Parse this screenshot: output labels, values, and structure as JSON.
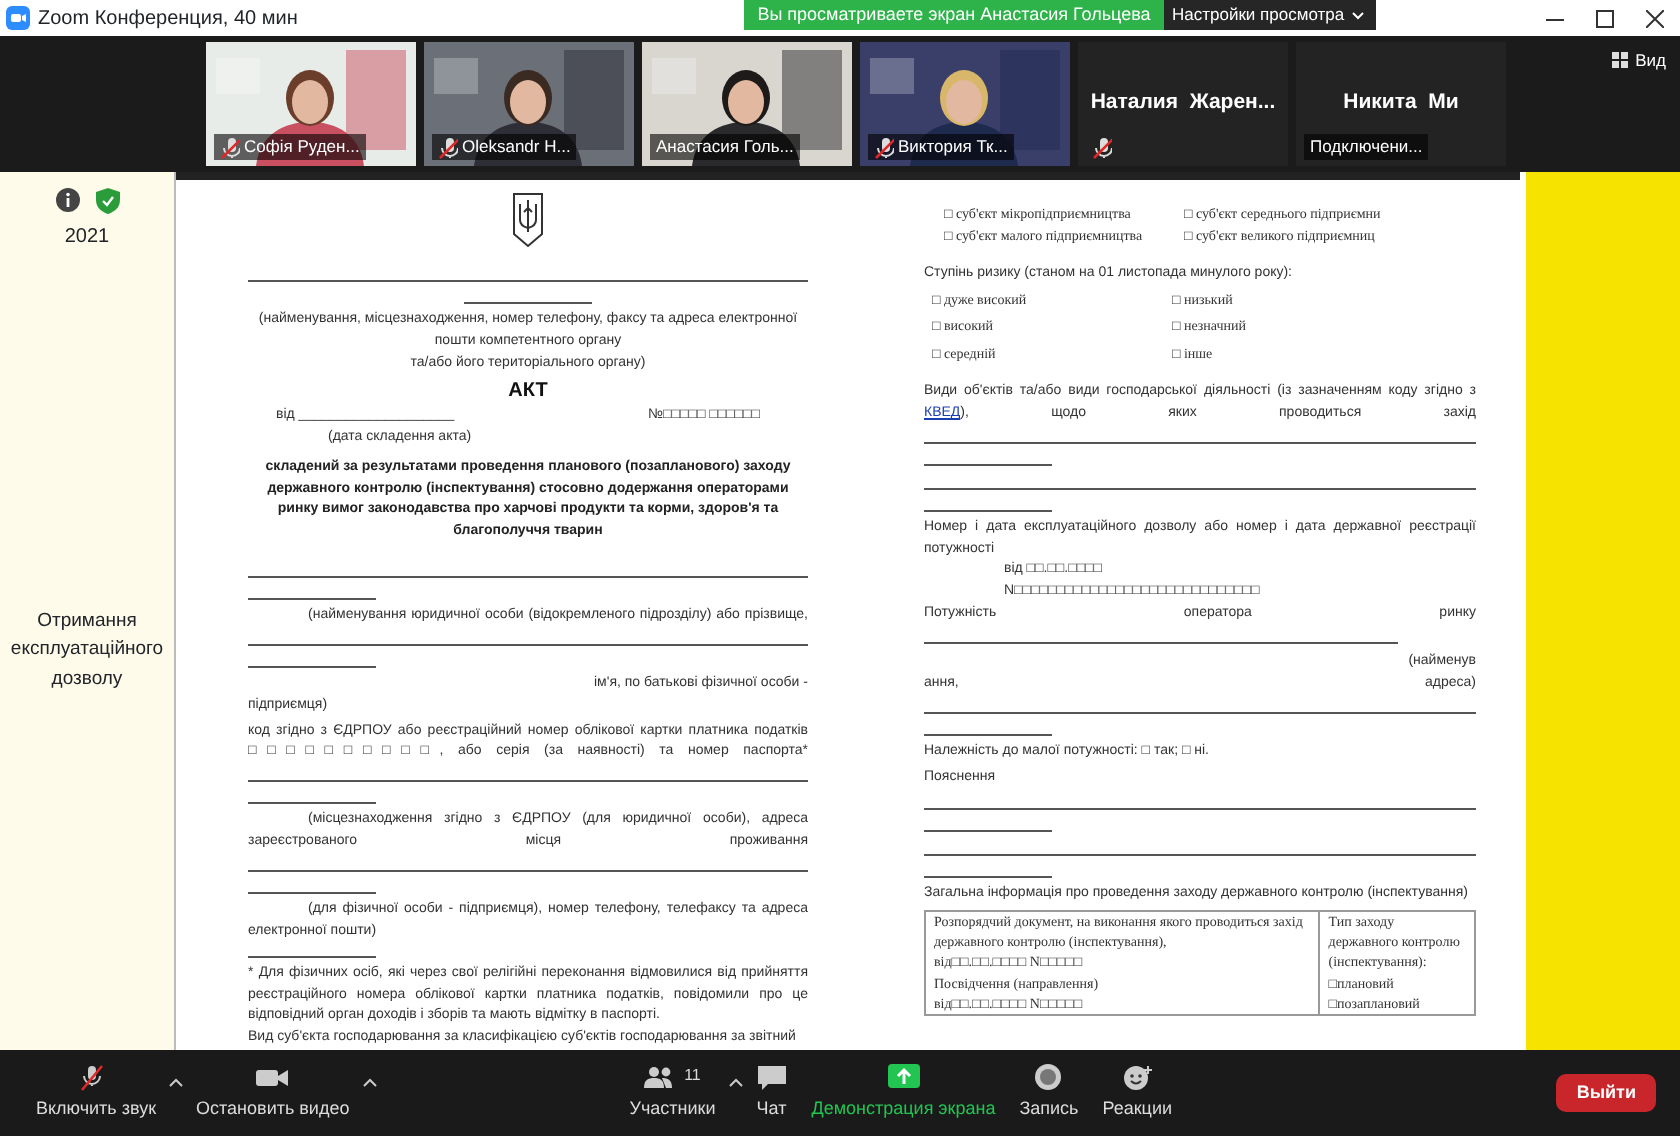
{
  "window": {
    "title": "Zoom Конференция, 40 мин"
  },
  "share_banner": {
    "text": "Вы просматриваете экран Анастасия Гольцева"
  },
  "view_options": {
    "label": "Настройки просмотра"
  },
  "view_button": {
    "label": "Вид"
  },
  "participants": [
    {
      "name": "Софія Руден...",
      "muted": true,
      "video": true,
      "speaking": false
    },
    {
      "name": "Oleksandr H...",
      "muted": true,
      "video": true,
      "speaking": false
    },
    {
      "name": "Анастасия Голь...",
      "muted": false,
      "video": true,
      "speaking": true
    },
    {
      "name": "Виктория Тк...",
      "muted": true,
      "video": true,
      "speaking": false
    },
    {
      "name": "Наталия  Жарен...",
      "muted": true,
      "video": false,
      "speaking": false
    },
    {
      "name": "Никита  Ми",
      "status": "Подключени...",
      "muted": false,
      "video": false,
      "speaking": false
    }
  ],
  "sidebar": {
    "year": "2021",
    "title": "Отримання експлуатаційного дозволу"
  },
  "document": {
    "left": [
      {
        "kind": "emblem"
      },
      {
        "kind": "rule"
      },
      {
        "kind": "short-rule-center"
      },
      {
        "kind": "center",
        "text": "(найменування, місцезнаходження, номер телефону, факсу та адреса електронної пошти компетентного органу"
      },
      {
        "kind": "center",
        "text": "та/або його територіального органу)"
      },
      {
        "kind": "title",
        "text": "АКТ"
      },
      {
        "kind": "split",
        "parts": [
          "від ____________________",
          "№□□□□□ □□□□□□"
        ]
      },
      {
        "kind": "indent",
        "text": "(дата складення акта)"
      },
      {
        "kind": "bold-center",
        "text": "складений за результатами проведення планового (позапланового) заходу державного контролю (інспектування) стосовно додержання операторами ринку вимог законодавства про харчові продукти та корми, здоров'я та благополуччя тварин"
      },
      {
        "kind": "rule"
      },
      {
        "kind": "short-rule"
      },
      {
        "kind": "justify-full-indent",
        "text": "(найменування юридичної особи (відокремленого підрозділу) або прізвище,"
      },
      {
        "kind": "rule"
      },
      {
        "kind": "short-rule"
      },
      {
        "kind": "right",
        "text": "ім'я, по батькові фізичної особи -"
      },
      {
        "kind": "plain",
        "text": "підприємця)"
      },
      {
        "kind": "justify-full",
        "text": "код згідно з ЄДРПОУ або реєстраційний номер облікової картки платника податків □□□□□□□□□□, або серія (за наявності) та номер паспорта*"
      },
      {
        "kind": "rule"
      },
      {
        "kind": "short-rule"
      },
      {
        "kind": "justify-full-indent",
        "text": "(місцезнаходження згідно з ЄДРПОУ (для юридичної особи), адреса зареєстрованого місця проживання"
      },
      {
        "kind": "rule"
      },
      {
        "kind": "short-rule"
      },
      {
        "kind": "justify-indent",
        "text": "(для фізичної особи - підприємця), номер телефону, телефаксу та адреса електронної пошти)"
      },
      {
        "kind": "short-rule"
      },
      {
        "kind": "justify",
        "text": "* Для фізичних осіб, які через свої релігійні переконання відмовилися від прийняття реєстраційного номера облікової картки платника податків, повідомили про це відповідний орган доходів і зборів та мають відмітку в паспорті."
      },
      {
        "kind": "plain",
        "text": "Вид суб'єкта господарювання за класифікацією суб'єктів господарювання за звітний"
      }
    ],
    "right": [
      {
        "kind": "checkbox-grid-wide",
        "items": [
          "□ суб'єкт мікропідприємництва",
          "□ суб'єкт середнього підприємни",
          "□ суб'єкт малого підприємництва",
          "□ суб'єкт великого підприємниц"
        ]
      },
      {
        "kind": "plain",
        "text": "Ступінь ризику (станом на 01 листопада минулого року):"
      },
      {
        "kind": "checkbox-grid",
        "items": [
          "□ дуже високий",
          "□ низький",
          "□ високий",
          "□ незначний",
          "□ середній",
          "□ інше"
        ]
      },
      {
        "kind": "link-para",
        "parts": [
          {
            "text": "Види об'єктів та/або види господарської діяльності (із зазначенням коду згідно з "
          },
          {
            "text": "КВЕД",
            "link": true
          },
          {
            "text": "), щодо яких проводиться захід"
          }
        ]
      },
      {
        "kind": "rule"
      },
      {
        "kind": "short-rule"
      },
      {
        "kind": "rule"
      },
      {
        "kind": "short-rule"
      },
      {
        "kind": "justify-full",
        "text": "Номер і дата експлуатаційного дозволу або номер і дата державної реєстрації потужності"
      },
      {
        "kind": "indent",
        "text": "від □□.□□.□□□□"
      },
      {
        "kind": "indent",
        "text": "N□□□□□□□□□□□□□□□□□□□□□□□□□□□□□"
      },
      {
        "kind": "justify-full",
        "text": "Потужність оператора ринку"
      },
      {
        "kind": "rule-long"
      },
      {
        "kind": "right",
        "text": "(найменув"
      },
      {
        "kind": "justify-full",
        "text": "ання, адреса)"
      },
      {
        "kind": "rule"
      },
      {
        "kind": "short-rule"
      },
      {
        "kind": "plain",
        "text": "Належність до малої потужності: □ так; □ ні."
      },
      {
        "kind": "plain",
        "text": "Пояснення"
      },
      {
        "kind": "rule"
      },
      {
        "kind": "short-rule"
      },
      {
        "kind": "rule"
      },
      {
        "kind": "short-rule"
      },
      {
        "kind": "plain",
        "text": "Загальна інформація про проведення заходу державного контролю (інспектування)"
      },
      {
        "kind": "table",
        "cells": [
          [
            "Розпорядчий документ, на виконання якого проводиться захід державного контролю (інспектування),",
            "від□□.□□.□□□□ N□□□□□",
            "Посвідчення (направлення)",
            "від□□.□□.□□□□ N□□□□□"
          ],
          [
            "Тип заходу державного контролю (інспектування):",
            "□плановий",
            "□позаплановий"
          ]
        ]
      }
    ]
  },
  "toolbar": {
    "items": [
      {
        "kind": "mic",
        "label": "Включить звук",
        "muted": true,
        "caret": true
      },
      {
        "kind": "video",
        "label": "Остановить видео",
        "caret": true
      },
      {
        "kind": "participants",
        "label": "Участники",
        "count": "11",
        "caret": true
      },
      {
        "kind": "chat",
        "label": "Чат",
        "caret": false
      },
      {
        "kind": "share",
        "label": "Демонстрация экрана",
        "caret": false
      },
      {
        "kind": "record",
        "label": "Запись",
        "caret": false
      },
      {
        "kind": "reactions",
        "label": "Реакции",
        "caret": false
      }
    ],
    "leave": "Выйти"
  }
}
